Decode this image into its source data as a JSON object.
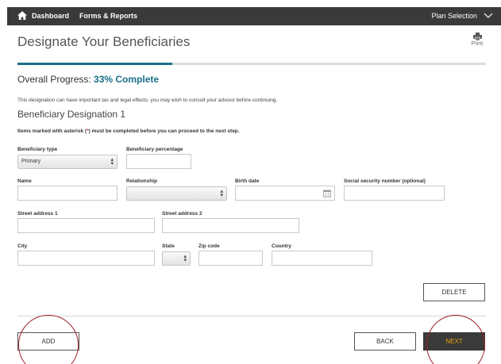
{
  "topbar": {
    "home_icon": "home-icon",
    "dashboard": "Dashboard",
    "forms_reports": "Forms & Reports",
    "plan_selection": "Plan Selection",
    "chevron_icon": "chevron-down-icon"
  },
  "page": {
    "title": "Designate Your Beneficiaries",
    "print_label": "Print",
    "print_icon": "printer-icon"
  },
  "progress": {
    "label": "Overall Progress: ",
    "percent_text": "33% Complete",
    "fraction": 0.33,
    "color": "#1b7087"
  },
  "notice": "This designation can have important tax and legal effects: you may wish to consult your advisor before continuing.",
  "section": {
    "title": "Beneficiary Designation 1",
    "required_before": "Items marked with asterisk (",
    "required_ast": "*",
    "required_after": ") must be completed before you can proceed to the next step."
  },
  "form": {
    "beneficiary_type_label": "Beneficiary type",
    "beneficiary_type_value": "Primary",
    "beneficiary_percentage_label": "Beneficiary percentage",
    "beneficiary_percentage_value": "",
    "name_label": "Name",
    "name_value": "",
    "relationship_label": "Relationship",
    "relationship_value": "",
    "birth_date_label": "Birth date",
    "birth_date_value": "",
    "ssn_label": "Social security number (optional)",
    "ssn_value": "",
    "street1_label": "Street address 1",
    "street1_value": "",
    "street2_label": "Street address 2",
    "street2_value": "",
    "city_label": "City",
    "city_value": "",
    "state_label": "State",
    "state_value": "",
    "zip_label": "Zip code",
    "zip_value": "",
    "country_label": "Country",
    "country_value": ""
  },
  "buttons": {
    "delete": "DELETE",
    "add": "ADD",
    "back": "BACK",
    "next": "NEXT"
  },
  "colors": {
    "topbar": "#3a3a3a",
    "accent": "#1b7087",
    "next_text": "#e8a10e",
    "highlight_circle": "#a02030"
  }
}
